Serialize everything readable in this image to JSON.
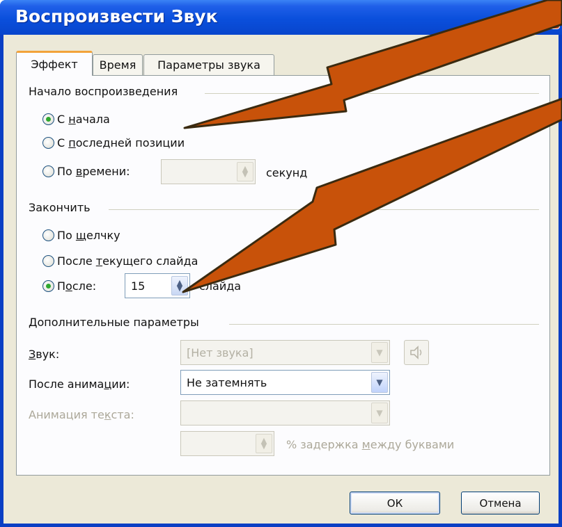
{
  "window": {
    "title": "Воспроизвести Звук"
  },
  "tabs": [
    {
      "label": "Эффект",
      "active": true
    },
    {
      "label": "Время",
      "active": false
    },
    {
      "label": "Параметры звука",
      "active": false
    }
  ],
  "start_group": {
    "label": "Начало воспроизведения",
    "options": [
      {
        "pre": "С ",
        "u": "н",
        "post": "ачала",
        "checked": true
      },
      {
        "pre": "С ",
        "u": "п",
        "post": "оследней позиции",
        "checked": false
      },
      {
        "pre": "По ",
        "u": "в",
        "post": "ремени:",
        "checked": false
      }
    ],
    "time_value": "",
    "time_unit": "секунд"
  },
  "stop_group": {
    "label": "Закончить",
    "options": [
      {
        "pre": "По ",
        "u": "щ",
        "post": "елчку",
        "checked": false
      },
      {
        "pre": "После ",
        "u": "т",
        "post": "екущего слайда",
        "checked": false
      },
      {
        "pre": "П",
        "u": "о",
        "post": "сле:",
        "checked": true
      }
    ],
    "after_value": "15",
    "after_unit": "слайда"
  },
  "extra_group": {
    "label": "Дополнительные параметры",
    "sound_label_u": "З",
    "sound_label_rest": "вук:",
    "sound_value": "[Нет звука]",
    "after_anim_label_pre": "После анима",
    "after_anim_label_u": "ц",
    "after_anim_label_post": "ии:",
    "after_anim_value": "Не затемнять",
    "text_anim_label_pre": "Анимация те",
    "text_anim_label_u": "к",
    "text_anim_label_post": "ста:",
    "text_anim_value": "",
    "delay_value": "",
    "delay_label_pre": "% задержка ",
    "delay_label_u": "м",
    "delay_label_post": "ежду буквами"
  },
  "buttons": {
    "ok": "ОК",
    "cancel": "Отмена"
  },
  "icons": {
    "sound": "speaker-icon",
    "spin": "spin-arrows-icon",
    "dropdown": "chevron-down-icon",
    "close": "close-icon"
  },
  "colors": {
    "titlebar": "#0a4fdc",
    "dialog_bg": "#ece9d8",
    "arrow_fill": "#c8520a",
    "arrow_outline": "#3a2a10",
    "radio_dot": "#2fa82f"
  }
}
